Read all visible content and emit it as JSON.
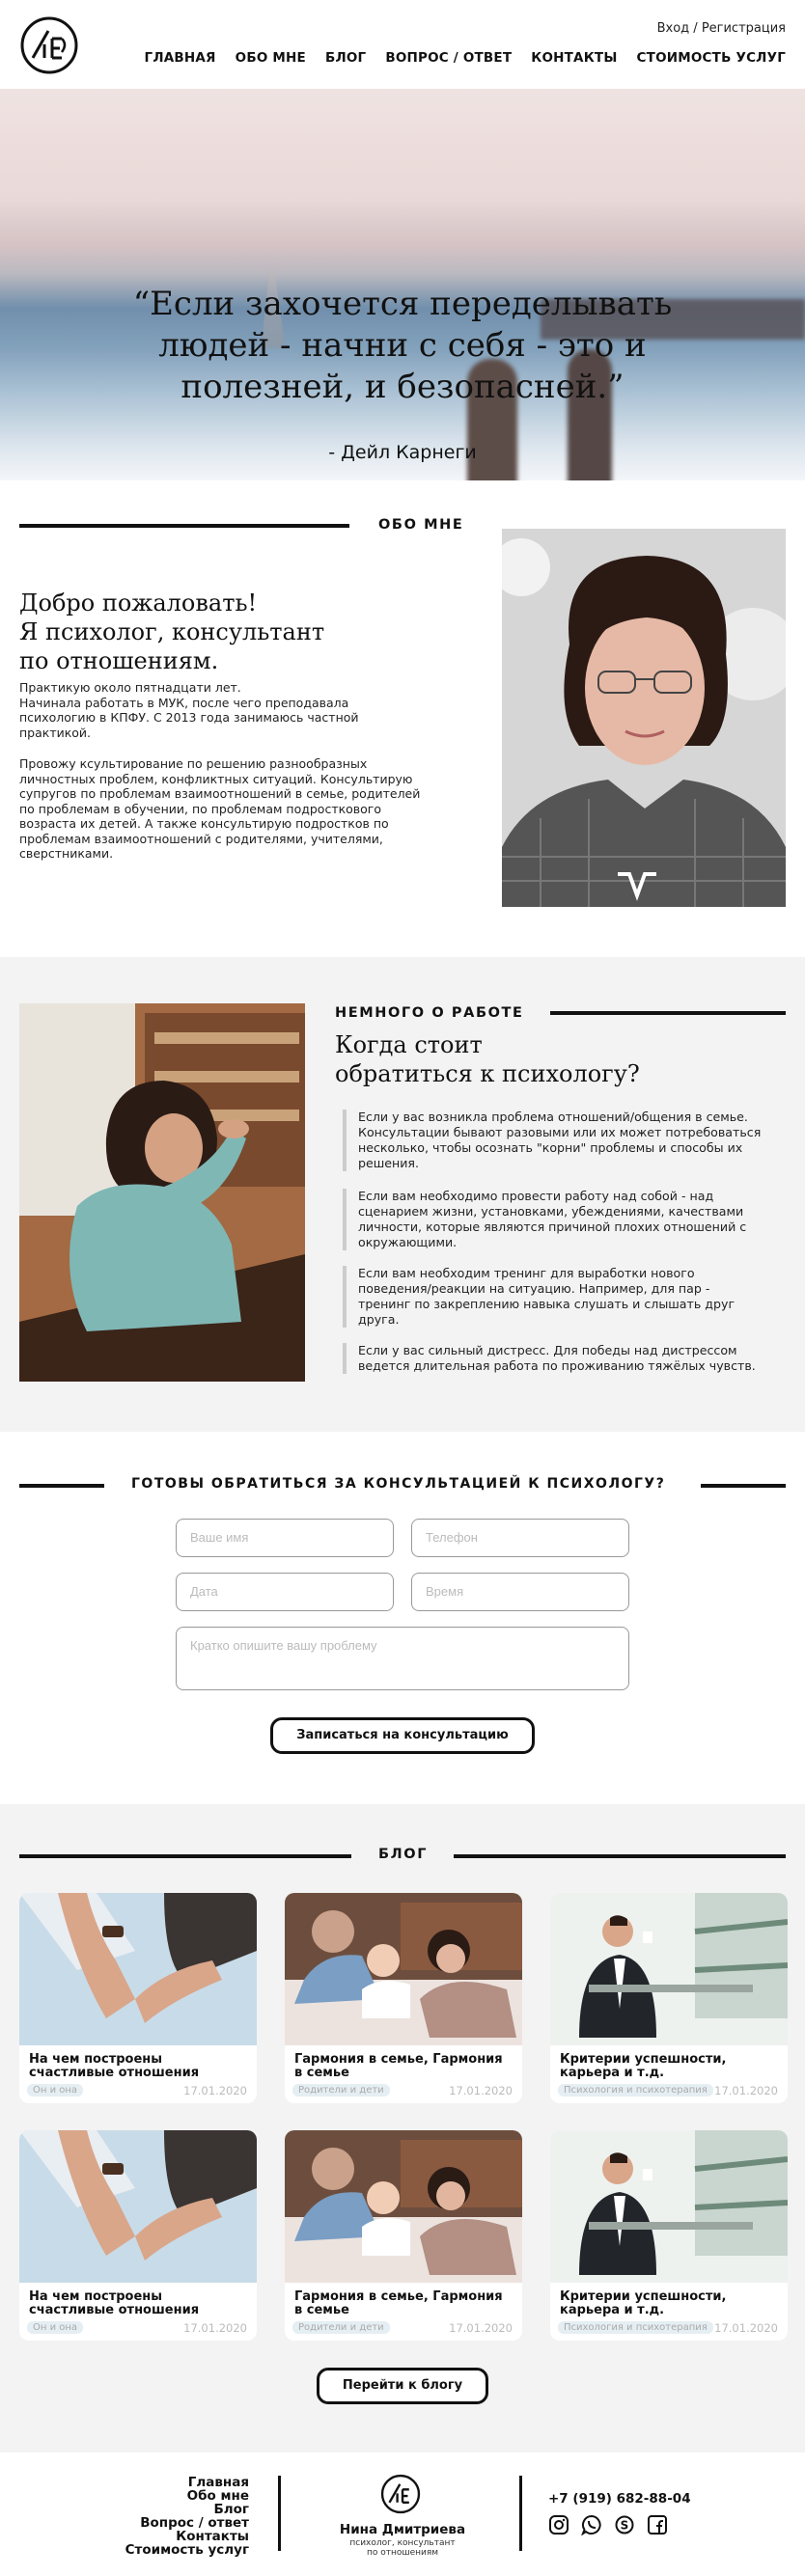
{
  "header": {
    "login": "Вход",
    "auth_sep": " / ",
    "register": "Регистрация",
    "nav": [
      "ГЛАВНАЯ",
      "ОБО МНЕ",
      "БЛОГ",
      "ВОПРОС / ОТВЕТ",
      "КОНТАКТЫ",
      "СТОИМОСТЬ УСЛУГ"
    ]
  },
  "hero": {
    "quote_lines": [
      "“Если захочется переделывать",
      "людей - начни с себя - это и",
      "полезней, и безопасней.”"
    ],
    "author": "- Дейл Карнеги",
    "slide_current": 2,
    "slide_total": 3
  },
  "about": {
    "section_title": "ОБО МНЕ",
    "heading_lines": [
      "Добро пожаловать!",
      "Я психолог, консультант",
      "по отношениям."
    ],
    "p1_lines": [
      "Практикую около пятнадцати лет.",
      "Начинала работать в МУК, после чего преподавала",
      "психологию в КПФУ. С 2013 года занимаюсь частной",
      "практикой."
    ],
    "p2_lines": [
      "Провожу ксультирование по решению разнообразных",
      "личностных проблем, конфликтных ситуаций. Консультирую",
      "супругов по проблемам взаимоотношений в семье, родителей",
      "по проблемам в обучении, по проблемам подросткового",
      "возраста их детей. А также консультирую подростков по",
      "проблемам взаимоотношений с родителями, учителями,",
      "сверстниками."
    ]
  },
  "work": {
    "section_title": "НЕМНОГО О РАБОТЕ",
    "heading_lines": [
      "Когда стоит",
      "обратиться к психологу?"
    ],
    "items": [
      [
        "Если у вас возникла проблема отношений/общения в семье.",
        "Консультации бывают разовыми или их может потребоваться",
        "несколько, чтобы осознать \"корни\" проблемы и способы их",
        "решения."
      ],
      [
        "Если вам необходимо провести работу над собой - над",
        "сценарием жизни, установками, убеждениями, качествами",
        "личности, которые являются причиной плохих отношений с",
        "окружающими."
      ],
      [
        "Если вам необходим тренинг для выработки нового",
        "поведения/реакции на ситуацию. Например, для пар -",
        "тренинг по закреплению навыка слушать и слышать друг",
        "друга."
      ],
      [
        "Если у вас сильный дистресс. Для победы над дистрессом",
        "ведется длительная работа по проживанию тяжёлых чувств."
      ]
    ]
  },
  "form": {
    "section_title": "ГОТОВЫ ОБРАТИТЬСЯ ЗА КОНСУЛЬТАЦИЕЙ К ПСИХОЛОГУ?",
    "name_placeholder": "Ваше имя",
    "phone_placeholder": "Телефон",
    "date_placeholder": "Дата",
    "time_placeholder": "Время",
    "problem_placeholder": "Кратко опишите вашу проблему",
    "submit": "Записаться на консультацию"
  },
  "blog": {
    "section_title": "БЛОГ",
    "cards": [
      {
        "title_lines": [
          "На чем построены",
          "счастливые отношения"
        ],
        "tag": "Он и она",
        "date": "17.01.2020",
        "img": "hands"
      },
      {
        "title_lines": [
          "Гармония в семье, Гармония",
          "в семье"
        ],
        "tag": "Родители и дети",
        "date": "17.01.2020",
        "img": "family"
      },
      {
        "title_lines": [
          "Критерии успешности,",
          "карьера и т.д."
        ],
        "tag": "Психология и психотерапия",
        "date": "17.01.2020",
        "img": "business"
      },
      {
        "title_lines": [
          "На чем построены",
          "счастливые отношения"
        ],
        "tag": "Он и она",
        "date": "17.01.2020",
        "img": "hands"
      },
      {
        "title_lines": [
          "Гармония в семье, Гармония",
          "в семье"
        ],
        "tag": "Родители и дети",
        "date": "17.01.2020",
        "img": "family"
      },
      {
        "title_lines": [
          "Критерии успешности,",
          "карьера и т.д."
        ],
        "tag": "Психология и психотерапия",
        "date": "17.01.2020",
        "img": "business"
      }
    ],
    "button": "Перейти к блогу"
  },
  "footer": {
    "nav": [
      "Главная",
      "Обо мне",
      "Блог",
      "Вопрос / ответ",
      "Контакты",
      "Стоимость услуг"
    ],
    "name": "Нина Дмитриева",
    "subtitle_lines": [
      "психолог, консультант",
      "по отношениям"
    ],
    "phone": "+7 (919) 682-88-04",
    "social_icons": [
      "instagram-icon",
      "whatsapp-icon",
      "skype-icon",
      "facebook-icon"
    ]
  }
}
